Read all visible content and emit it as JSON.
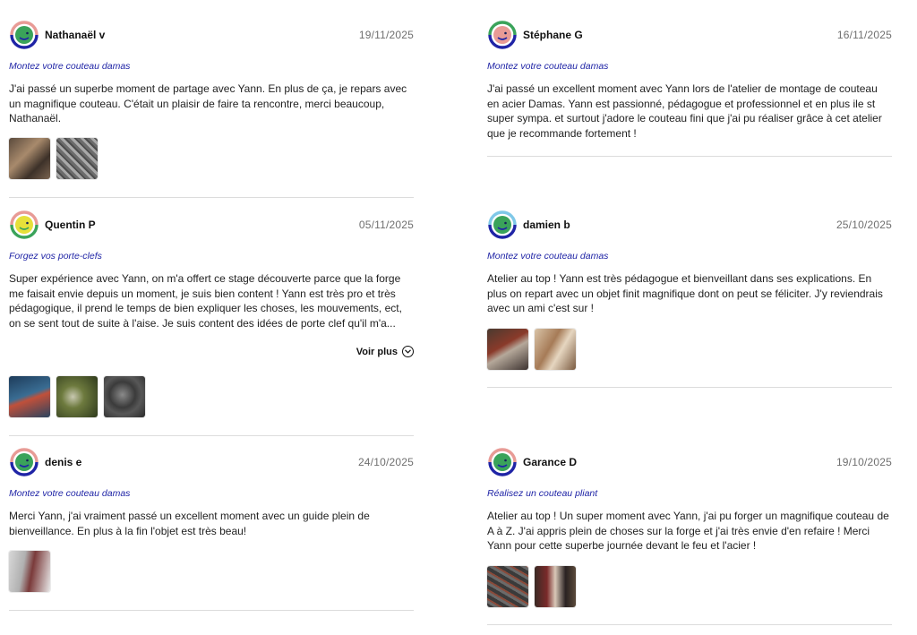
{
  "reviews": [
    {
      "author": "Nathanaël v",
      "date": "19/11/2025",
      "workshop": "Montez votre couteau damas",
      "text": "J'ai passé un superbe moment de partage avec Yann. En plus de ça, je repars avec un magnifique couteau. C'était un plaisir de faire ta rencontre, merci beaucoup, Nathanaël.",
      "avatar_colors": [
        "#e89b96",
        "#3aa35a",
        "#1f24a6"
      ],
      "photos": [
        "forge-photo",
        "knife-photo"
      ]
    },
    {
      "author": "Stéphane G",
      "date": "16/11/2025",
      "workshop": "Montez votre couteau damas",
      "text": "J'ai passé un excellent moment avec Yann lors de l'atelier de montage de couteau en acier Damas. Yann est passionné, pédagogue et professionnel et en plus ile st super sympa. et surtout j'adore le couteau fini que j'ai pu réaliser grâce à cet atelier que je recommande fortement !",
      "avatar_colors": [
        "#3aa35a",
        "#e89b96",
        "#1f24a6"
      ],
      "photos": []
    },
    {
      "author": "Quentin P",
      "date": "05/11/2025",
      "workshop": "Forgez vos porte-clefs",
      "text": "Super expérience avec Yann, on m'a offert ce stage découverte parce que la forge me faisait envie depuis un moment, je suis bien content ! Yann est très pro et très pédagogique, il prend le temps de bien expliquer les choses, les mouvements, ect, on se sent tout de suite à l'aise. Je suis content des idées de porte clef qu'il m'a...",
      "more_label": "Voir plus",
      "avatar_colors": [
        "#e89b96",
        "#e6e03a",
        "#3aa35a"
      ],
      "photos": [
        "forge-photo",
        "keychain-photo",
        "keychain-photo"
      ]
    },
    {
      "author": "damien b",
      "date": "25/10/2025",
      "workshop": "Montez votre couteau damas",
      "text": "Atelier au top ! Yann est très pédagogue et bienveillant dans ses explications. En plus on repart avec un objet finit magnifique dont on peut se féliciter. J'y reviendrais avec un ami c'est sur !",
      "avatar_colors": [
        "#7fc8e8",
        "#3aa35a",
        "#1f24a6"
      ],
      "photos": [
        "knife-photo",
        "workshop-photo"
      ]
    },
    {
      "author": "denis e",
      "date": "24/10/2025",
      "workshop": "Montez votre couteau damas",
      "text": "Merci Yann, j'ai vraiment passé un excellent moment avec un guide plein de bienveillance. En plus à la fin l'objet est très beau!",
      "avatar_colors": [
        "#e89b96",
        "#3aa35a",
        "#1f24a6"
      ],
      "photos": [
        "knife-photo"
      ]
    },
    {
      "author": "Garance D",
      "date": "19/10/2025",
      "workshop": "Réalisez un couteau pliant",
      "text": "Atelier au top ! Un super moment avec Yann, j'ai pu forger un magnifique couteau de A à Z. J'ai appris plein de choses sur la forge et j'ai très envie d'en refaire ! Merci Yann pour cette superbe journée devant le feu et l'acier !",
      "avatar_colors": [
        "#e89b96",
        "#3aa35a",
        "#1f24a6"
      ],
      "photos": [
        "knife-photo",
        "workshop-photo"
      ]
    }
  ]
}
